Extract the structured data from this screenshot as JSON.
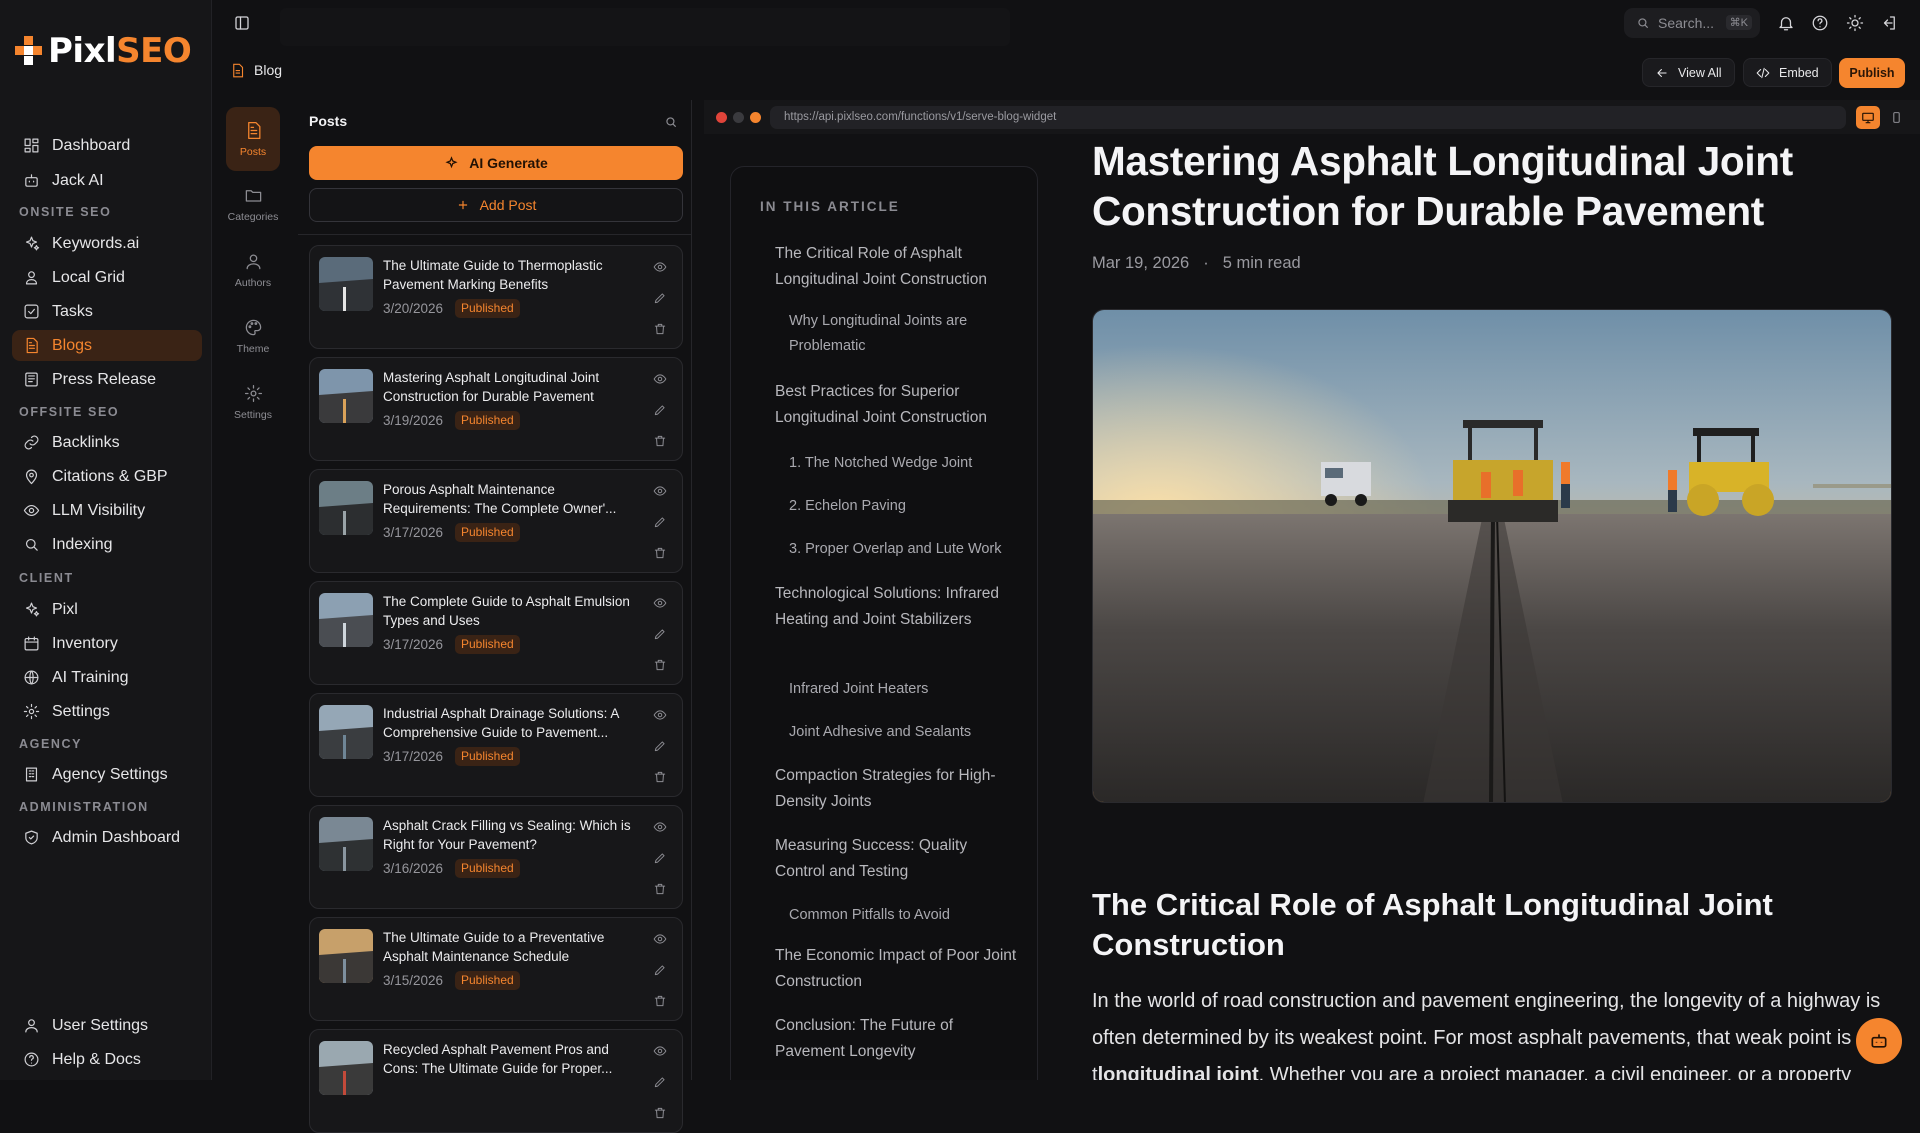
{
  "app": {
    "logo": {
      "part1": "Pixl",
      "part2": "SEO"
    },
    "sidebar": {
      "items": [
        {
          "label": "Dashboard",
          "icon": "dashboard-icon"
        },
        {
          "label": "Jack AI",
          "icon": "bot-icon"
        }
      ],
      "sections": [
        {
          "title": "ONSITE SEO",
          "items": [
            "Keywords.ai",
            "Local Grid",
            "Tasks",
            "Blogs",
            "Press Release"
          ]
        },
        {
          "title": "OFFSITE SEO",
          "items": [
            "Backlinks",
            "Citations & GBP",
            "LLM Visibility",
            "Indexing"
          ]
        },
        {
          "title": "CLIENT",
          "items": [
            "Pixl",
            "Inventory",
            "AI Training",
            "Settings"
          ]
        },
        {
          "title": "AGENCY",
          "items": [
            "Agency Settings"
          ]
        },
        {
          "title": "ADMINISTRATION",
          "items": [
            "Admin Dashboard"
          ]
        }
      ],
      "footer": [
        "User Settings",
        "Help & Docs"
      ],
      "active": "Blogs"
    }
  },
  "topbar": {
    "search_placeholder": "Search...",
    "search_shortcut": "⌘K"
  },
  "header": {
    "breadcrumb": "Blog",
    "view_all": "View All",
    "embed": "Embed",
    "publish": "Publish"
  },
  "subnav": [
    "Posts",
    "Categories",
    "Authors",
    "Theme",
    "Settings"
  ],
  "posts": {
    "title": "Posts",
    "ai_generate": "AI Generate",
    "add_post": "Add Post",
    "items": [
      {
        "title": "The Ultimate Guide to Thermoplastic Pavement Marking Benefits",
        "date": "3/20/2026",
        "status": "Published"
      },
      {
        "title": "Mastering Asphalt Longitudinal Joint Construction for Durable Pavement",
        "date": "3/19/2026",
        "status": "Published"
      },
      {
        "title": "Porous Asphalt Maintenance Requirements: The Complete Owner'...",
        "date": "3/17/2026",
        "status": "Published"
      },
      {
        "title": "The Complete Guide to Asphalt Emulsion Types and Uses",
        "date": "3/17/2026",
        "status": "Published"
      },
      {
        "title": "Industrial Asphalt Drainage Solutions: A Comprehensive Guide to Pavement...",
        "date": "3/17/2026",
        "status": "Published"
      },
      {
        "title": "Asphalt Crack Filling vs Sealing: Which is Right for Your Pavement?",
        "date": "3/16/2026",
        "status": "Published"
      },
      {
        "title": "The Ultimate Guide to a Preventative Asphalt Maintenance Schedule",
        "date": "3/15/2026",
        "status": "Published"
      },
      {
        "title": "Recycled Asphalt Pavement Pros and Cons: The Ultimate Guide for Proper...",
        "date": "",
        "status": ""
      }
    ]
  },
  "preview": {
    "url": "https://api.pixlseo.com/functions/v1/serve-blog-widget",
    "toc_heading": "IN THIS ARTICLE",
    "toc": [
      {
        "label": "The Critical Role of Asphalt Longitudinal Joint Construction",
        "level": 1
      },
      {
        "label": "Why Longitudinal Joints are Problematic",
        "level": 2
      },
      {
        "label": "Best Practices for Superior Longitudinal Joint Construction",
        "level": 1
      },
      {
        "label": "1. The Notched Wedge Joint",
        "level": 2
      },
      {
        "label": "2. Echelon Paving",
        "level": 2
      },
      {
        "label": "3. Proper Overlap and Lute Work",
        "level": 2
      },
      {
        "label": "Technological Solutions: Infrared Heating and Joint Stabilizers",
        "level": 1
      },
      {
        "label": "Infrared Joint Heaters",
        "level": 2
      },
      {
        "label": "Joint Adhesive and Sealants",
        "level": 2
      },
      {
        "label": "Compaction Strategies for High-Density Joints",
        "level": 1
      },
      {
        "label": "Measuring Success: Quality Control and Testing",
        "level": 1
      },
      {
        "label": "Common Pitfalls to Avoid",
        "level": 2
      },
      {
        "label": "The Economic Impact of Poor Joint Construction",
        "level": 1
      },
      {
        "label": "Conclusion: The Future of Pavement Longevity",
        "level": 1
      }
    ],
    "article": {
      "title": "Mastering Asphalt Longitudinal Joint Construction for Durable Pavement",
      "date": "Mar 19, 2026",
      "separator": "·",
      "read_time": "5 min read",
      "section_heading": "The Critical Role of Asphalt Longitudinal Joint Construction",
      "paragraph_start": "In the world of road construction and pavement engineering, the longevity of a highway is often determined by its weakest point. For most asphalt pavements, that weak point is t",
      "paragraph_bold": "longitudinal joint",
      "paragraph_end": ". Whether you are a project manager, a civil engineer, or a property owner"
    }
  },
  "colors": {
    "accent": "#f5852e",
    "bg": "#111113",
    "panel": "#161618"
  }
}
